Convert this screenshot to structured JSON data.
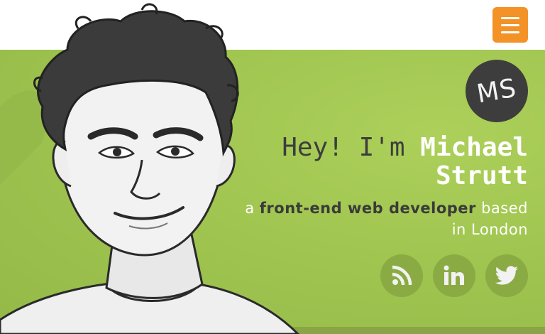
{
  "header": {
    "menu_icon": "hamburger-menu-icon",
    "menu_color": "#f39226"
  },
  "logo": {
    "initials": "MS"
  },
  "hero": {
    "greeting": "Hey! I'm",
    "name": "Michael Strutt",
    "tagline_prefix": "a",
    "tagline_role": "front-end web developer",
    "tagline_suffix": "based in London",
    "background_color": "#9cc04e"
  },
  "social": [
    {
      "icon": "rss-icon"
    },
    {
      "icon": "linkedin-icon"
    },
    {
      "icon": "twitter-icon"
    }
  ]
}
